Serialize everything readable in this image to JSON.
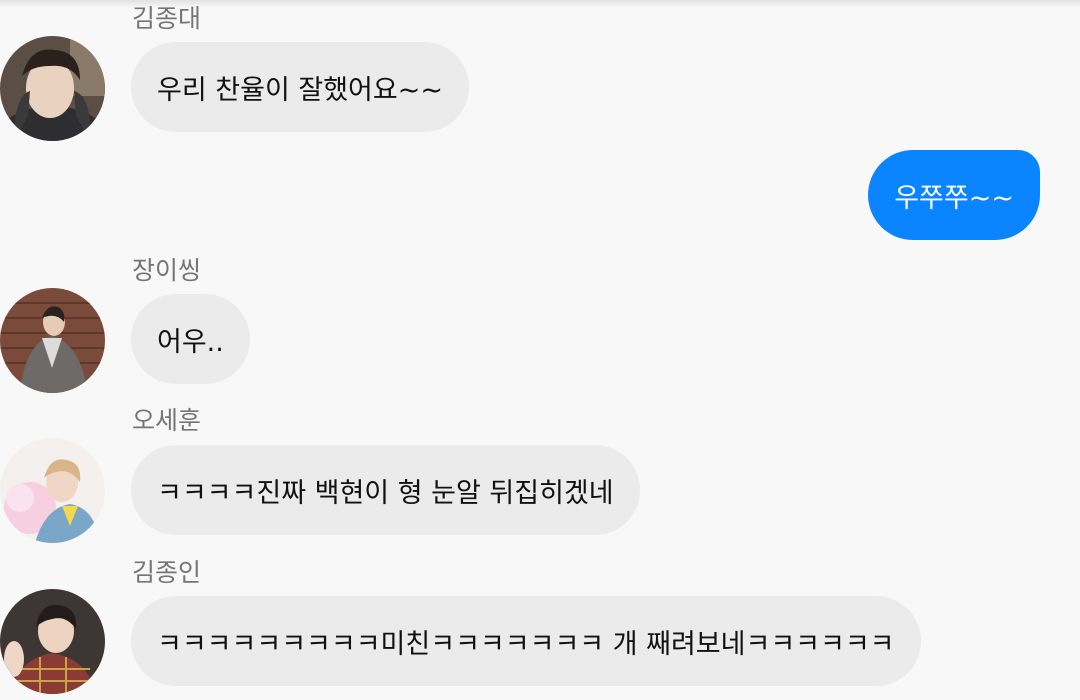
{
  "colors": {
    "background": "#f8f8f8",
    "incoming_bubble": "#ebebeb",
    "outgoing_bubble": "#0a84ff",
    "sender_name": "#757575"
  },
  "messages": [
    {
      "sender": "김종대",
      "text": "우리 찬율이 잘했어요~~",
      "direction": "incoming",
      "avatar": "avatar-photo"
    },
    {
      "sender": "",
      "text": "우쭈쭈~~",
      "direction": "outgoing"
    },
    {
      "sender": "장이씽",
      "text": "어우..",
      "direction": "incoming",
      "avatar": "avatar-photo"
    },
    {
      "sender": "오세훈",
      "text": "ㅋㅋㅋㅋ진짜 백현이 형 눈알 뒤집히겠네",
      "direction": "incoming",
      "avatar": "avatar-photo"
    },
    {
      "sender": "김종인",
      "text": "ㅋㅋㅋㅋㅋㅋㅋㅋㅋ미친ㅋㅋㅋㅋㅋㅋㅋ 개 째려보네ㅋㅋㅋㅋㅋㅋ",
      "direction": "incoming",
      "avatar": "avatar-photo"
    }
  ]
}
